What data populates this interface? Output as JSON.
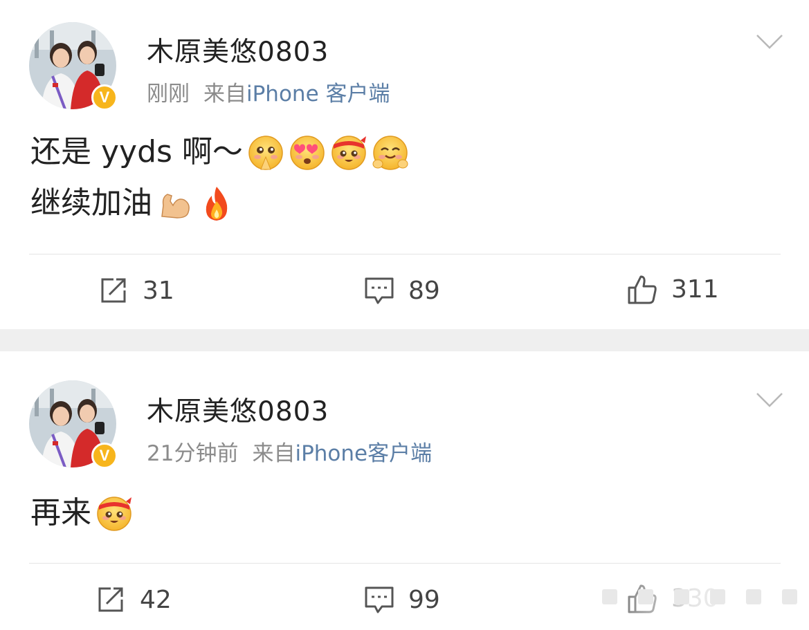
{
  "posts": [
    {
      "username": "木原美悠0803",
      "time": "刚刚",
      "source_prefix": "来自",
      "client": "iPhone 客户端",
      "content_lines": [
        "还是 yyds 啊～",
        "继续加油"
      ],
      "emojis_line1": [
        "pleading-hands-emoji",
        "heart-eyes-emoji",
        "headband-fighting-emoji",
        "hug-emoji"
      ],
      "emojis_line2": [
        "flexed-biceps-emoji",
        "fire-emoji"
      ],
      "reposts": "31",
      "comments": "89",
      "likes": "311"
    },
    {
      "username": "木原美悠0803",
      "time": "21分钟前",
      "source_prefix": "来自",
      "client": "iPhone客户端",
      "content_lines": [
        "再来"
      ],
      "emojis_line1": [
        "headband-fighting-emoji"
      ],
      "reposts": "42",
      "comments": "99",
      "likes": "330"
    }
  ],
  "colors": {
    "verified_badge": "#f7b51c",
    "client_link": "#5b7ea6",
    "meta_gray": "#8b8b8b",
    "separator": "#efefef"
  },
  "icons": [
    "repost-icon",
    "comment-icon",
    "like-icon",
    "chevron-down-icon",
    "verified-badge-icon"
  ]
}
